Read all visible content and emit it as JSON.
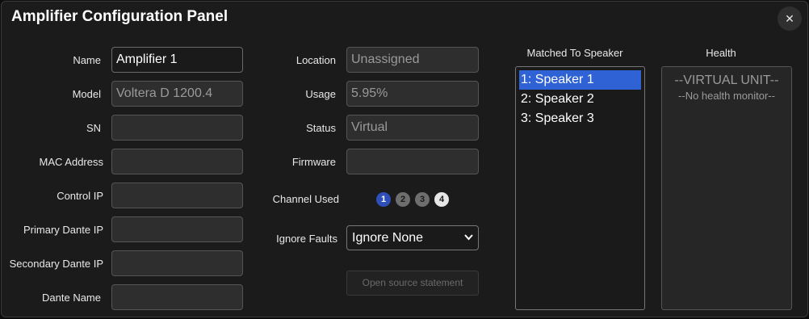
{
  "title": "Amplifier Configuration Panel",
  "close_glyph": "✕",
  "left": {
    "name_label": "Name",
    "name_value": "Amplifier 1",
    "model_label": "Model",
    "model_value": "Voltera D 1200.4",
    "sn_label": "SN",
    "sn_value": "",
    "mac_label": "MAC Address",
    "mac_value": "",
    "control_ip_label": "Control IP",
    "control_ip_value": "",
    "primary_dante_label": "Primary Dante IP",
    "primary_dante_value": "",
    "secondary_dante_label": "Secondary Dante IP",
    "secondary_dante_value": "",
    "dante_name_label": "Dante Name",
    "dante_name_value": ""
  },
  "middle": {
    "location_label": "Location",
    "location_value": "Unassigned",
    "usage_label": "Usage",
    "usage_value": "5.95%",
    "status_label": "Status",
    "status_value": "Virtual",
    "firmware_label": "Firmware",
    "firmware_value": "",
    "channel_label": "Channel Used",
    "channels": [
      "1",
      "2",
      "3",
      "4"
    ],
    "ignore_faults_label": "Ignore Faults",
    "ignore_faults_value": "Ignore None",
    "open_source_button": "Open source statement"
  },
  "speakers": {
    "header": "Matched To Speaker",
    "items": [
      "1: Speaker 1",
      "2: Speaker 2",
      "3: Speaker 3"
    ],
    "selected_index": 0
  },
  "health": {
    "header": "Health",
    "line1": "--VIRTUAL UNIT--",
    "line2": "--No health monitor--"
  },
  "colors": {
    "selected": "#2f62d4",
    "channel_active": "#2f4fb8",
    "channel_inactive": "#6e6e6e",
    "channel_light": "#e6e6e6"
  }
}
